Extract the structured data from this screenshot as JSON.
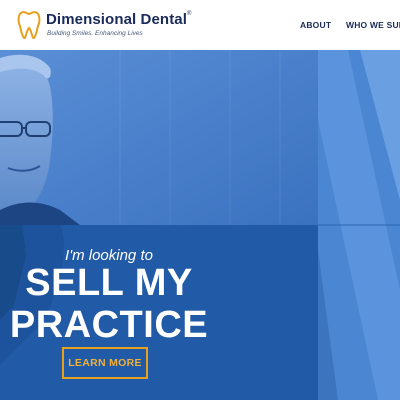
{
  "brand": {
    "name": "Dimensional Dental",
    "trademark": "®",
    "tagline": "Building Smiles. Enhancing Lives",
    "logo_icon": "tooth-icon",
    "logo_color": "#e8a021"
  },
  "nav": {
    "items": [
      {
        "label": "ABOUT"
      },
      {
        "label": "WHO WE SUPP"
      }
    ]
  },
  "hero": {
    "subhead": "I'm looking to",
    "headline_line1": "SELL MY",
    "headline_line2": "PRACTICE",
    "cta_label": "LEARN MORE",
    "accent_color": "#e8a021",
    "overlay_color": "#2a62b0"
  }
}
